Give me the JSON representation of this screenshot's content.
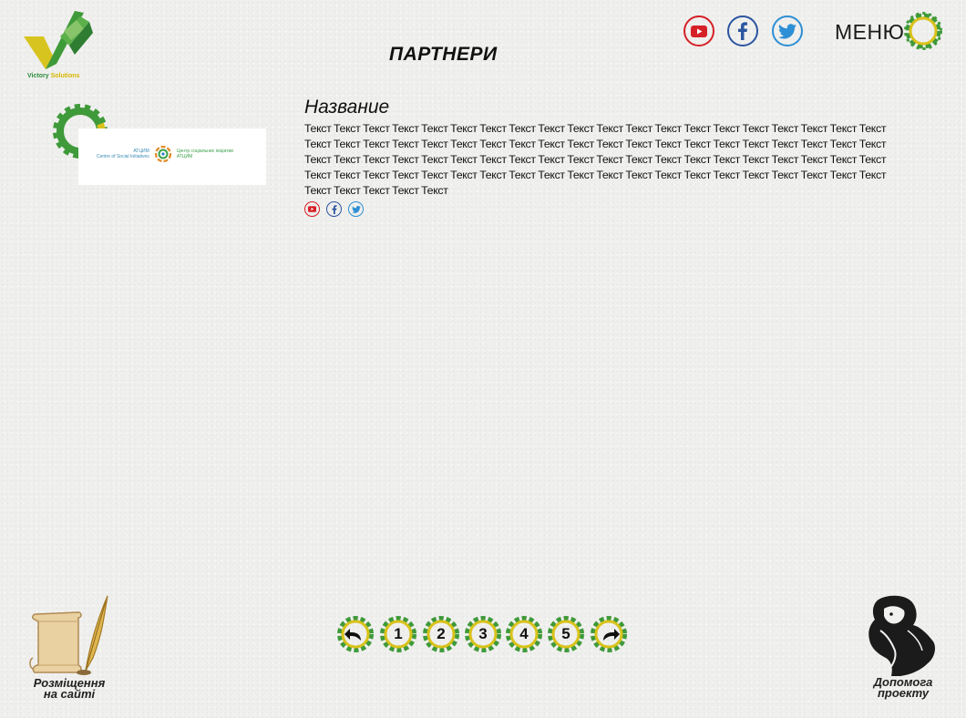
{
  "header": {
    "logo_text_main": "Victory",
    "logo_text_accent": "Solutions",
    "page_title": "ПАРТНЕРИ",
    "menu_label": "МЕНЮ",
    "social": [
      "youtube-icon",
      "facebook-icon",
      "twitter-icon"
    ]
  },
  "partner": {
    "name": "Название",
    "logo_left_line1": "АТЦИМ",
    "logo_left_line2": "Centre of Social Initiatives",
    "logo_right_line1": "Центр соціальних ініціатив",
    "logo_right_line2": "АТЦИМ",
    "description": "Текст Текст Текст Текст Текст Текст Текст Текст Текст Текст Текст Текст Текст Текст Текст Текст Текст Текст Текст Текст Текст Текст Текст Текст Текст Текст Текст Текст Текст Текст Текст Текст Текст Текст Текст Текст Текст Текст Текст Текст Текст Текст Текст Текст Текст Текст Текст Текст Текст Текст Текст Текст Текст Текст Текст Текст Текст Текст Текст Текст Текст Текст Текст Текст Текст Текст Текст Текст Текст Текст Текст Текст Текст Текст Текст Текст Текст Текст Текст Текст Текст Текст Текст Текст Текст"
  },
  "pagination": {
    "pages": [
      "1",
      "2",
      "3",
      "4",
      "5"
    ]
  },
  "footer": {
    "placement_line1": "Розміщення",
    "placement_line2": "на сайті",
    "help_line1": "Допомога",
    "help_line2": "проекту"
  },
  "colors": {
    "gear_green": "#3f9a3a",
    "gear_yellow": "#d9c21b",
    "youtube": "#d62027",
    "facebook": "#2b55a0",
    "twitter": "#2d8fd5"
  }
}
